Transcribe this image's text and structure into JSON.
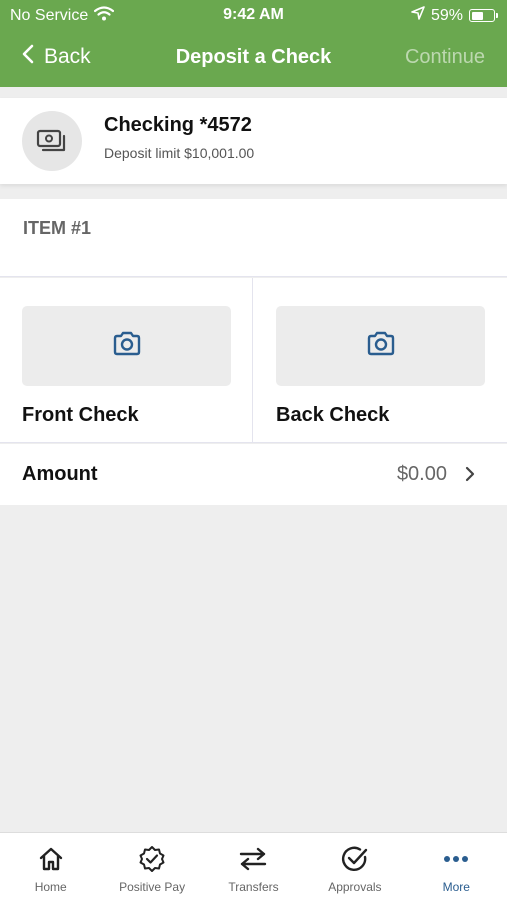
{
  "status_bar": {
    "carrier": "No Service",
    "time": "9:42 AM",
    "battery": "59%",
    "battery_level": 0.59
  },
  "nav": {
    "back_label": "Back",
    "title": "Deposit a Check",
    "continue_label": "Continue"
  },
  "account": {
    "name": "Checking *4572",
    "limit": "Deposit limit $10,001.00",
    "icon": "cash-icon"
  },
  "item": {
    "label": "ITEM #1"
  },
  "checks": {
    "front_label": "Front Check",
    "back_label": "Back Check",
    "icon": "camera-icon"
  },
  "amount": {
    "label": "Amount",
    "value": "$0.00"
  },
  "tabs": [
    {
      "label": "Home",
      "icon": "home-icon"
    },
    {
      "label": "Positive Pay",
      "icon": "badge-check-icon"
    },
    {
      "label": "Transfers",
      "icon": "transfer-arrows-icon"
    },
    {
      "label": "Approvals",
      "icon": "check-circle-icon"
    },
    {
      "label": "More",
      "icon": "more-dots-icon",
      "active": true
    }
  ],
  "colors": {
    "header_green": "#6aa84f",
    "accent_blue": "#2a5d8f"
  }
}
